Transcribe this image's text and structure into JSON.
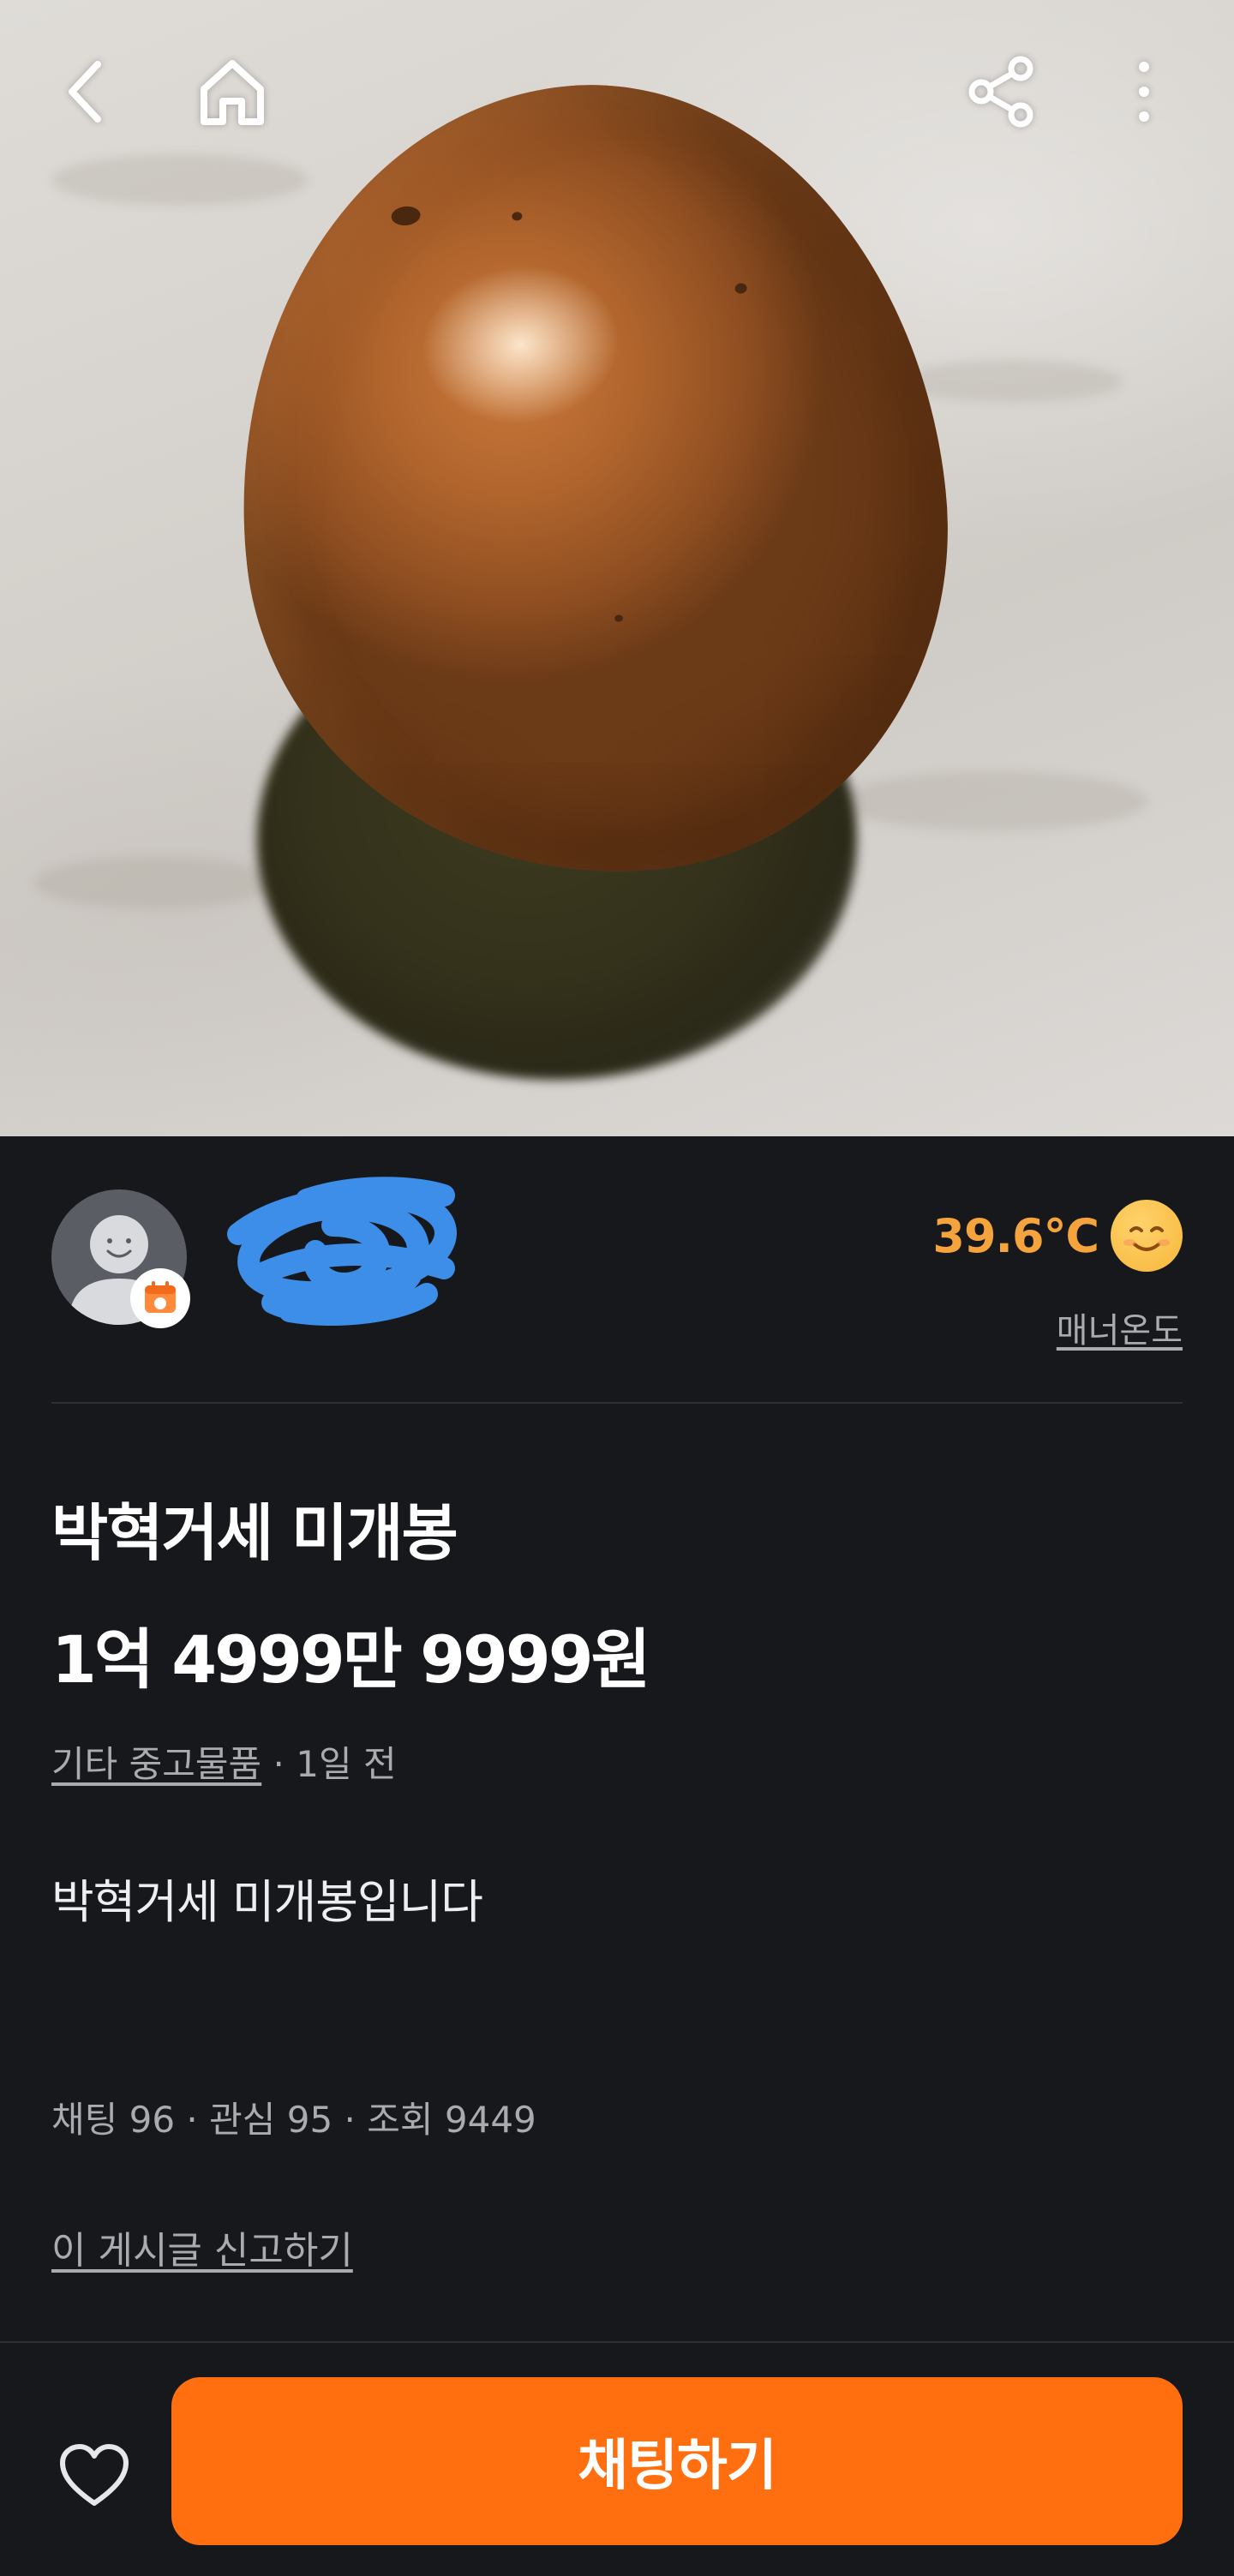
{
  "product": {
    "title": "박혁거세 미개봉",
    "price": "1억 4999만 9999원",
    "category": "기타 중고물품",
    "separator": " · ",
    "time_ago": "1일 전",
    "description": "박혁거세 미개봉입니다",
    "stats": "채팅 96 · 관심 95 · 조회 9449",
    "report_label": "이 게시글 신고하기"
  },
  "seller": {
    "manner_temp": "39.6℃",
    "manner_label": "매너온도"
  },
  "bottom": {
    "chat_label": "채팅하기"
  },
  "colors": {
    "accent": "#ff6f0f",
    "temperature": "#f5a33c",
    "background": "#17181c",
    "redaction": "#3c8ee8"
  },
  "icons": {
    "back": "back-icon",
    "home": "home-icon",
    "share": "share-icon",
    "more": "more-vertical-icon",
    "heart": "heart-icon",
    "badge": "calendar-badge-icon",
    "smile": "smiling-face-icon"
  }
}
